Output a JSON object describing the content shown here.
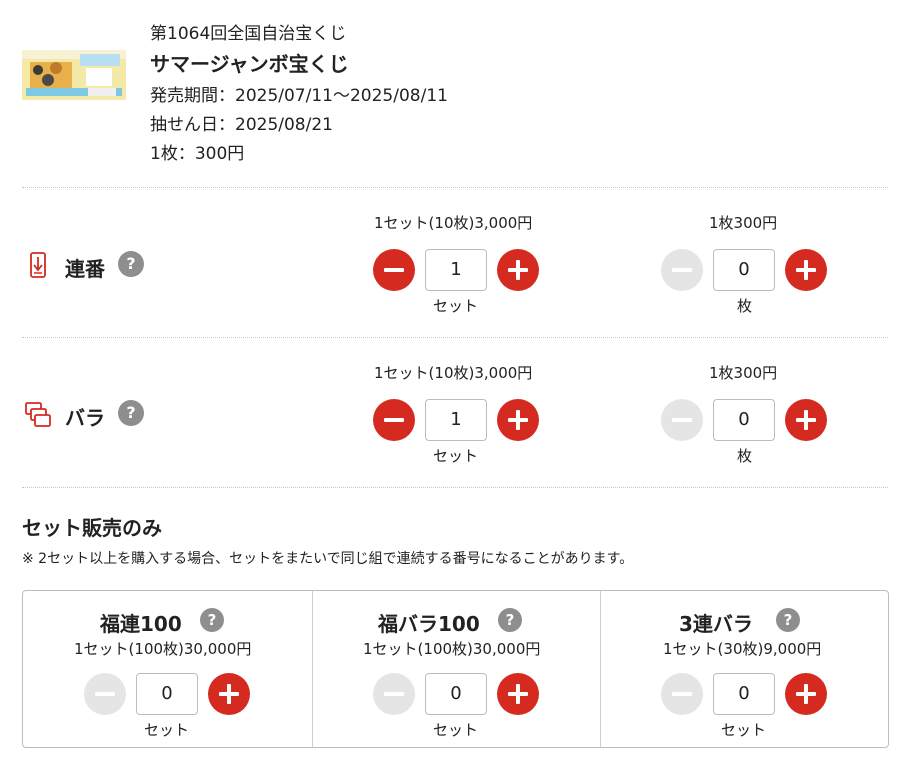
{
  "lottery": {
    "round": "第1064回全国自治宝くじ",
    "name": "サマージャンボ宝くじ",
    "sale_period": "発売期間：2025/07/11〜2025/08/11",
    "draw_date": "抽せん日：2025/08/21",
    "unit_price": "1枚：300円"
  },
  "rows": [
    {
      "name": "連番",
      "icon": "consecutive-number-icon",
      "set_price": "1セット(10枚)3,000円",
      "set_qty": "1",
      "set_unit": "セット",
      "single_price": "1枚300円",
      "single_qty": "0",
      "single_unit": "枚"
    },
    {
      "name": "バラ",
      "icon": "scattered-number-icon",
      "set_price": "1セット(10枚)3,000円",
      "set_qty": "1",
      "set_unit": "セット",
      "single_price": "1枚300円",
      "single_qty": "0",
      "single_unit": "枚"
    }
  ],
  "set_only": {
    "title": "セット販売のみ",
    "note": "※ 2セット以上を購入する場合、セットをまたいで同じ組で連続する番号になることがあります。",
    "items": [
      {
        "name": "福連100",
        "price": "1セット(100枚)30,000円",
        "qty": "0",
        "unit": "セット"
      },
      {
        "name": "福バラ100",
        "price": "1セット(100枚)30,000円",
        "qty": "0",
        "unit": "セット"
      },
      {
        "name": "3連バラ",
        "price": "1セット(30枚)9,000円",
        "qty": "0",
        "unit": "セット"
      }
    ]
  },
  "help_glyph": "?",
  "colors": {
    "accent": "#d52a1f",
    "disabled": "#e5e5e5",
    "help": "#8e8e8e"
  }
}
